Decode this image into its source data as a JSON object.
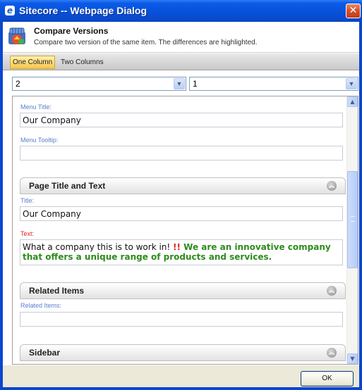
{
  "window": {
    "title": "Sitecore -- Webpage Dialog",
    "icon": "ie-icon",
    "close_symbol": "✕"
  },
  "header": {
    "title": "Compare Versions",
    "subtitle": "Compare two version of the same item. The differences are highlighted.",
    "icon": "compare-versions-icon"
  },
  "tabs": [
    {
      "label": "One Column",
      "active": true
    },
    {
      "label": "Two Columns",
      "active": false
    }
  ],
  "version_selects": {
    "left_value": "2",
    "right_value": "1"
  },
  "fields": {
    "menu_title_label": "Menu Title:",
    "menu_title_value": "Our Company",
    "menu_tooltip_label": "Menu Tooltip:",
    "menu_tooltip_value": "",
    "title_label": "Title:",
    "title_value": "Our Company",
    "text_label": "Text:",
    "text_unchanged": "What a company this is to work in! ",
    "text_deleted": "!!",
    "text_inserted": " We are an innovative company that offers a unique range of products and services.",
    "related_items_label": "Related Items:",
    "related_items_value": ""
  },
  "sections": [
    {
      "title": "Page Title and Text"
    },
    {
      "title": "Related Items"
    },
    {
      "title": "Sidebar"
    }
  ],
  "footer": {
    "ok_label": "OK"
  },
  "colors": {
    "titlebar": "#0a50d8",
    "label_blue": "#5a7fcf",
    "label_changed": "#e02020",
    "inserted_text": "#2e8b1e",
    "deleted_text": "#e02020",
    "active_tab": "#f6c64a"
  }
}
